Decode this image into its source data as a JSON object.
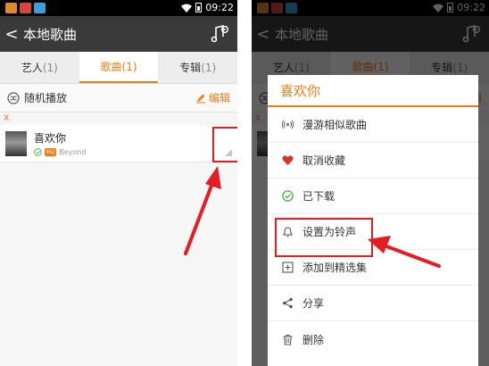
{
  "status_bar": {
    "time": "09:22"
  },
  "app_bar": {
    "back_glyph": "<",
    "title": "本地歌曲"
  },
  "tabs": [
    {
      "label": "艺人",
      "count": "(1)"
    },
    {
      "label": "歌曲",
      "count": "(1)"
    },
    {
      "label": "专辑",
      "count": "(1)"
    }
  ],
  "toolbar": {
    "shuffle_label": "随机播放",
    "edit_label": "编辑"
  },
  "list": {
    "section_letter": "X",
    "song": {
      "title": "喜欢你",
      "badge": "HQ",
      "artist": "Beyond"
    }
  },
  "menu": {
    "title": "喜欢你",
    "items": [
      {
        "label": "漫游相似歌曲",
        "icon": "radio-icon"
      },
      {
        "label": "取消收藏",
        "icon": "heart-icon"
      },
      {
        "label": "已下载",
        "icon": "check-circle-icon"
      },
      {
        "label": "设置为铃声",
        "icon": "bell-icon"
      },
      {
        "label": "添加到精选集",
        "icon": "add-box-icon"
      },
      {
        "label": "分享",
        "icon": "share-icon"
      },
      {
        "label": "删除",
        "icon": "trash-icon"
      }
    ]
  },
  "colors": {
    "accent": "#f17b14",
    "highlight": "#e61c23",
    "app_bar": "#3a3a3a"
  }
}
